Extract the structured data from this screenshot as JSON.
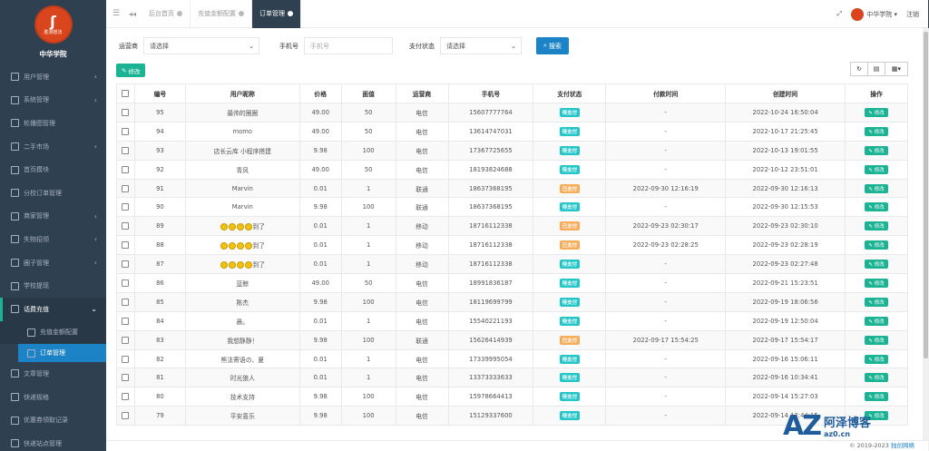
{
  "sidebar": {
    "logo_text": "胜测想法",
    "brand": "中华学院",
    "items": [
      {
        "label": "用户管理",
        "arrow": "‹"
      },
      {
        "label": "系统管理",
        "arrow": "‹"
      },
      {
        "label": "轮播图管理",
        "arrow": ""
      },
      {
        "label": "二手市场",
        "arrow": "‹"
      },
      {
        "label": "首页模块",
        "arrow": ""
      },
      {
        "label": "分校订单管理",
        "arrow": ""
      },
      {
        "label": "商家管理",
        "arrow": "‹"
      },
      {
        "label": "失物招领",
        "arrow": "‹"
      },
      {
        "label": "圈子管理",
        "arrow": "‹"
      },
      {
        "label": "学校提现",
        "arrow": ""
      },
      {
        "label": "话费充值",
        "arrow": "⌄"
      }
    ],
    "sub_items": [
      {
        "label": "充值金额配置"
      },
      {
        "label": "订单管理"
      }
    ],
    "items_after": [
      {
        "label": "文章管理"
      },
      {
        "label": "快递规格"
      },
      {
        "label": "优惠券领取记录"
      },
      {
        "label": "快递站点管理"
      }
    ]
  },
  "topbar": {
    "tabs": [
      {
        "label": "后台首页"
      },
      {
        "label": "充值金额配置"
      },
      {
        "label": "订单管理"
      }
    ],
    "user": "中华学院 ▾",
    "signout": "注销"
  },
  "filters": {
    "operator_label": "运营商",
    "operator_value": "请选择",
    "phone_label": "手机号",
    "phone_placeholder": "手机号",
    "pay_label": "支付状态",
    "pay_value": "请选择",
    "search": "搜索"
  },
  "toolbar": {
    "edit": "修改"
  },
  "table": {
    "headers": [
      "编号",
      "用户昵称",
      "价格",
      "面值",
      "运营商",
      "手机号",
      "支付状态",
      "付款时间",
      "创建时间",
      "操作"
    ],
    "op_label": "修改",
    "rows": [
      {
        "id": "95",
        "nick": "最帅的圈圈",
        "emoji": false,
        "price": "49.00",
        "value": "50",
        "carrier": "电信",
        "phone": "15607777764",
        "status": "待支付",
        "paid": false,
        "pay_time": "-",
        "created": "2022-10-24 16:50:04"
      },
      {
        "id": "94",
        "nick": "momo",
        "emoji": false,
        "price": "49.00",
        "value": "50",
        "carrier": "电信",
        "phone": "13614747031",
        "status": "待支付",
        "paid": false,
        "pay_time": "-",
        "created": "2022-10-17 21:25:45"
      },
      {
        "id": "93",
        "nick": "店长云库 小程序搭建",
        "emoji": false,
        "price": "9.98",
        "value": "100",
        "carrier": "电信",
        "phone": "17367725655",
        "status": "待支付",
        "paid": false,
        "pay_time": "-",
        "created": "2022-10-13 19:01:55"
      },
      {
        "id": "92",
        "nick": "青风",
        "emoji": false,
        "price": "49.00",
        "value": "50",
        "carrier": "电信",
        "phone": "18193824688",
        "status": "待支付",
        "paid": false,
        "pay_time": "-",
        "created": "2022-10-12 23:51:01"
      },
      {
        "id": "91",
        "nick": "Marvin",
        "emoji": false,
        "price": "0.01",
        "value": "1",
        "carrier": "联通",
        "phone": "18637368195",
        "status": "已支付",
        "paid": true,
        "pay_time": "2022-09-30 12:16:19",
        "created": "2022-09-30 12:16:13"
      },
      {
        "id": "90",
        "nick": "Marvin",
        "emoji": false,
        "price": "9.98",
        "value": "100",
        "carrier": "联通",
        "phone": "18637368195",
        "status": "待支付",
        "paid": false,
        "pay_time": "-",
        "created": "2022-09-30 12:15:53"
      },
      {
        "id": "89",
        "nick": "到了",
        "emoji": true,
        "price": "0.01",
        "value": "1",
        "carrier": "移动",
        "phone": "18716112338",
        "status": "已支付",
        "paid": true,
        "pay_time": "2022-09-23 02:30:17",
        "created": "2022-09-23 02:30:10"
      },
      {
        "id": "88",
        "nick": "到了",
        "emoji": true,
        "price": "0.01",
        "value": "1",
        "carrier": "移动",
        "phone": "18716112338",
        "status": "已支付",
        "paid": true,
        "pay_time": "2022-09-23 02:28:25",
        "created": "2022-09-23 02:28:19"
      },
      {
        "id": "87",
        "nick": "到了",
        "emoji": true,
        "price": "0.01",
        "value": "1",
        "carrier": "移动",
        "phone": "18716112338",
        "status": "待支付",
        "paid": false,
        "pay_time": "-",
        "created": "2022-09-23 02:27:48"
      },
      {
        "id": "86",
        "nick": "蓝鲸",
        "emoji": false,
        "price": "49.00",
        "value": "50",
        "carrier": "电信",
        "phone": "18991836187",
        "status": "待支付",
        "paid": false,
        "pay_time": "-",
        "created": "2022-09-21 15:23:51"
      },
      {
        "id": "85",
        "nick": "陈杰",
        "emoji": false,
        "price": "9.98",
        "value": "100",
        "carrier": "电信",
        "phone": "18119699799",
        "status": "待支付",
        "paid": false,
        "pay_time": "-",
        "created": "2022-09-19 18:06:56"
      },
      {
        "id": "84",
        "nick": "晨。",
        "emoji": false,
        "price": "0.01",
        "value": "1",
        "carrier": "电信",
        "phone": "15540221193",
        "status": "待支付",
        "paid": false,
        "pay_time": "-",
        "created": "2022-09-19 12:50:04"
      },
      {
        "id": "83",
        "nick": "我想静静！",
        "emoji": false,
        "price": "9.98",
        "value": "100",
        "carrier": "联通",
        "phone": "15626414939",
        "status": "已支付",
        "paid": true,
        "pay_time": "2022-09-17 15:54:25",
        "created": "2022-09-17 15:54:17"
      },
      {
        "id": "82",
        "nick": "熊法寄语の、夏",
        "emoji": false,
        "price": "0.01",
        "value": "1",
        "carrier": "电信",
        "phone": "17339995054",
        "status": "待支付",
        "paid": false,
        "pay_time": "-",
        "created": "2022-09-16 15:06:11"
      },
      {
        "id": "81",
        "nick": "时光狼人",
        "emoji": false,
        "price": "0.01",
        "value": "1",
        "carrier": "电信",
        "phone": "13373333633",
        "status": "待支付",
        "paid": false,
        "pay_time": "-",
        "created": "2022-09-16 10:34:41"
      },
      {
        "id": "80",
        "nick": "技术支持",
        "emoji": false,
        "price": "9.98",
        "value": "100",
        "carrier": "电信",
        "phone": "15978664413",
        "status": "待支付",
        "paid": false,
        "pay_time": "-",
        "created": "2022-09-14 15:27:03"
      },
      {
        "id": "79",
        "nick": "平安喜乐",
        "emoji": false,
        "price": "9.98",
        "value": "100",
        "carrier": "电信",
        "phone": "15129337600",
        "status": "待支付",
        "paid": false,
        "pay_time": "-",
        "created": "2022-09-14 12:44:15"
      }
    ]
  },
  "footer": {
    "copyright": "© 2019-2023 ",
    "link": "独创网络"
  },
  "watermark": {
    "logo": "AZ",
    "name": "阿泽博客",
    "url": "az0.cn"
  }
}
